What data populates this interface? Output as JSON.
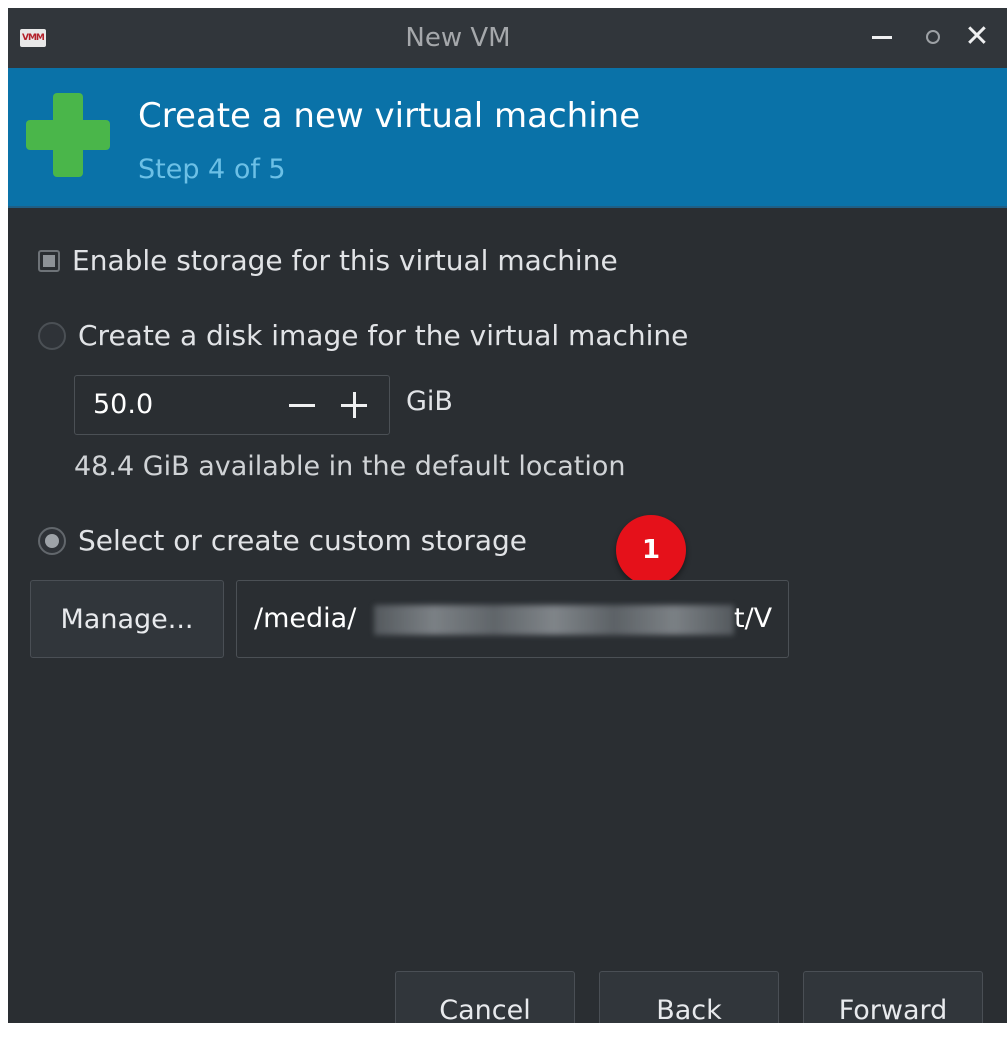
{
  "window": {
    "title": "New VM",
    "app_icon_text": "VMM"
  },
  "header": {
    "title": "Create a new virtual machine",
    "step": "Step 4 of 5",
    "icon": "plus-icon",
    "color": "#0a72a8"
  },
  "storage": {
    "enable_label": "Enable storage for this virtual machine",
    "enable_checked": true,
    "disk_image_label": "Create a disk image for the virtual machine",
    "disk_image_selected": false,
    "size_value": "50.0",
    "size_unit": "GiB",
    "available_text": "48.4 GiB available in the default location",
    "custom_label": "Select or create custom storage",
    "custom_selected": true,
    "manage_label": "Manage...",
    "path_prefix": "/media/",
    "path_suffix": "t/V"
  },
  "annotation": {
    "badge": "1",
    "color": "#e5111a"
  },
  "footer": {
    "cancel_label": "Cancel",
    "back_label": "Back",
    "forward_label": "Forward"
  }
}
